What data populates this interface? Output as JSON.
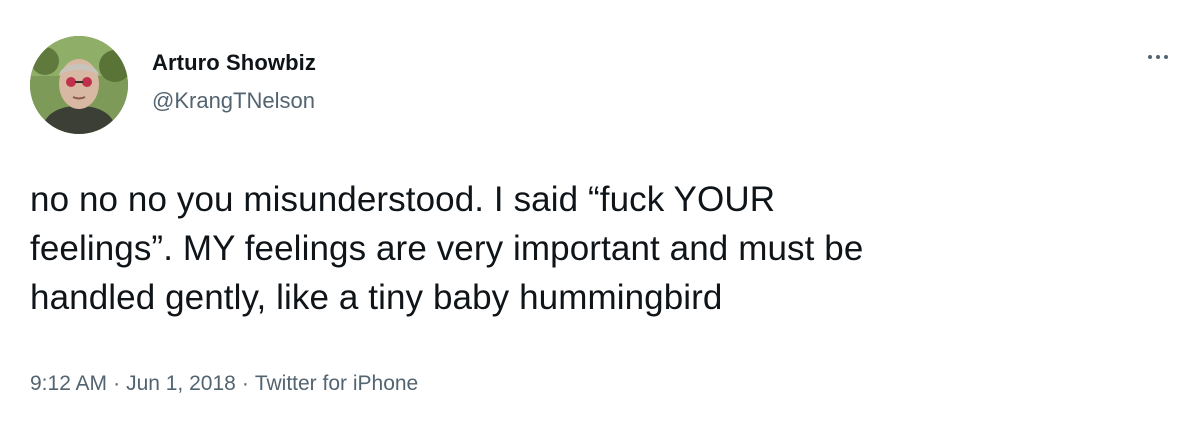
{
  "author": {
    "name": "Arturo Showbiz",
    "handle": "@KrangTNelson",
    "avatar_icon": "profile-photo"
  },
  "menu": {
    "icon": "more-options-icon"
  },
  "tweet": {
    "text": "no no no you misunderstood. I said “fuck YOUR\nfeelings”. MY feelings are very important and must be\nhandled gently, like a tiny baby hummingbird"
  },
  "meta": {
    "time": "9:12 AM",
    "date": "Jun 1, 2018",
    "source": "Twitter for iPhone",
    "separator": "·"
  },
  "colors": {
    "text": "#0f1419",
    "secondary": "#536471",
    "background": "#ffffff"
  }
}
